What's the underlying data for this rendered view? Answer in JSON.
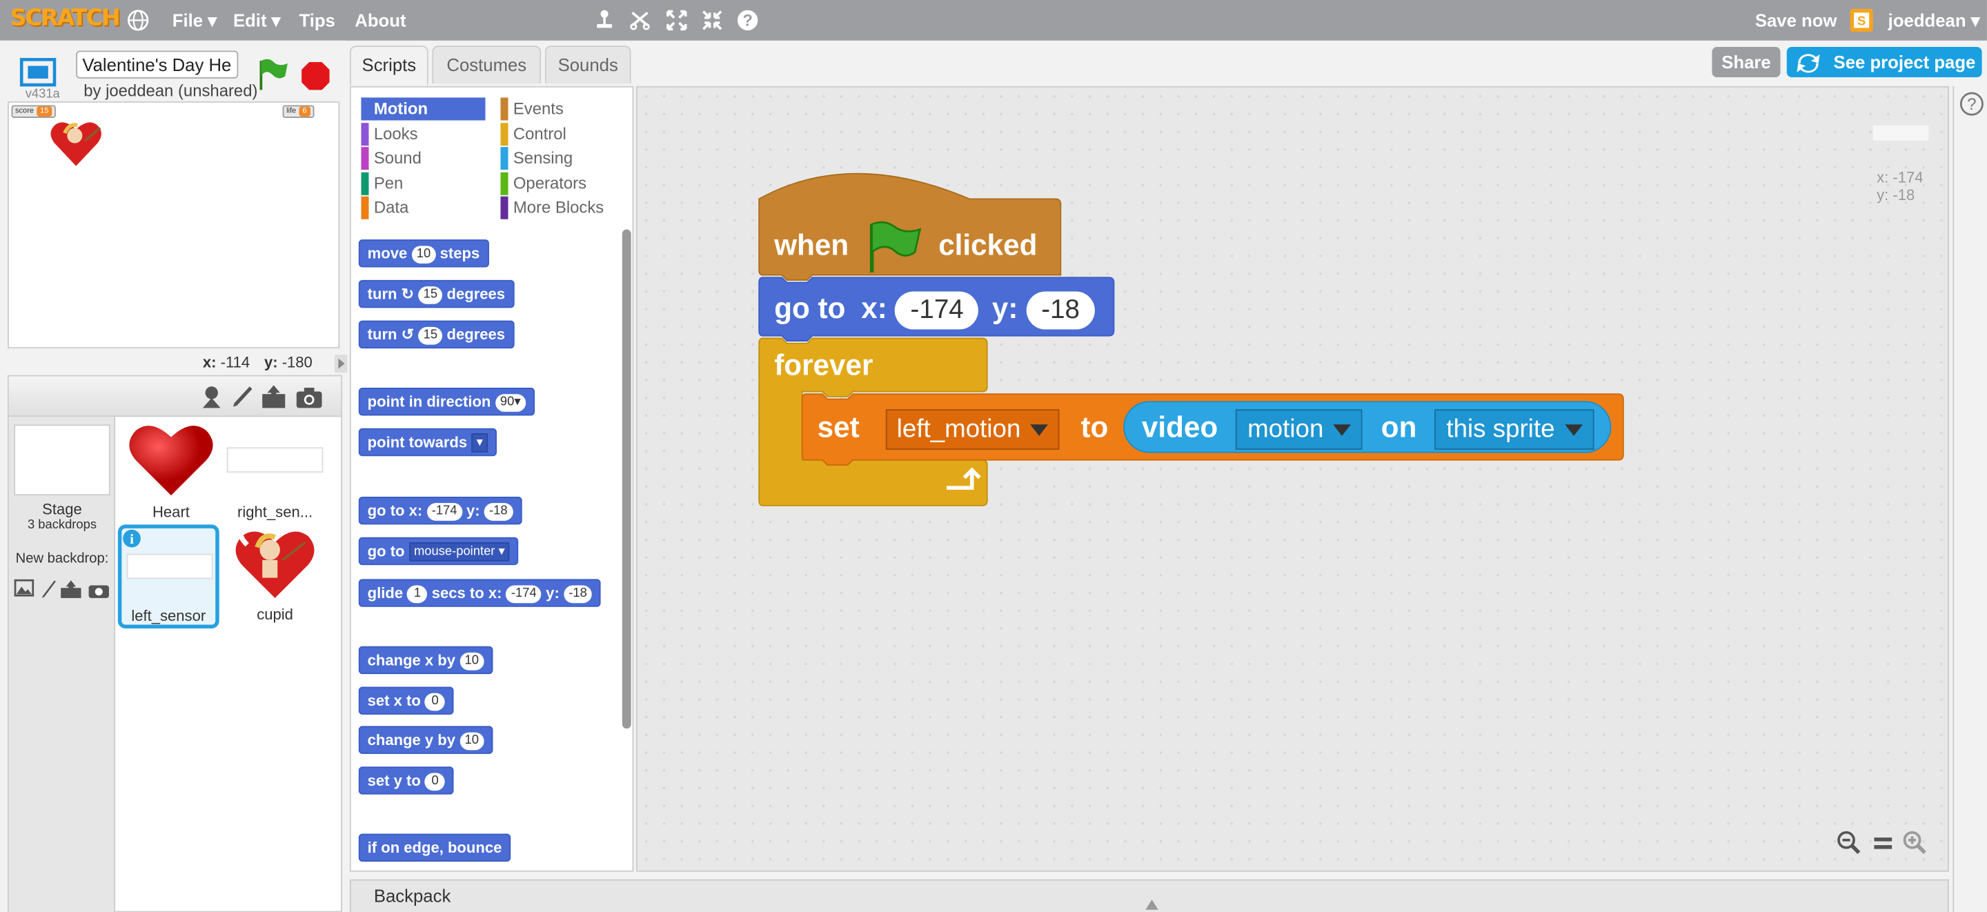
{
  "topbar": {
    "logo": "SCRATCH",
    "menus": [
      "File ▾",
      "Edit ▾",
      "Tips",
      "About"
    ],
    "save_now": "Save now",
    "username": "joeddean ▾"
  },
  "project": {
    "title": "Valentine's Day He",
    "author": "by joeddean (unshared)",
    "version": "v431a"
  },
  "stage": {
    "monitors": [
      {
        "label": "score",
        "value": "15"
      },
      {
        "label": "life",
        "value": "6"
      }
    ],
    "coords": {
      "x_label": "x:",
      "x": "-114",
      "y_label": "y:",
      "y": "-180"
    }
  },
  "sprite_pane": {
    "stage_label": "Stage",
    "backdrops": "3 backdrops",
    "new_backdrop": "New backdrop:",
    "sprites": [
      {
        "name": "Heart"
      },
      {
        "name": "right_sen..."
      },
      {
        "name": "left_sensor",
        "selected": true
      },
      {
        "name": "cupid"
      }
    ]
  },
  "tabs": [
    "Scripts",
    "Costumes",
    "Sounds"
  ],
  "categories": {
    "left": [
      {
        "name": "Motion",
        "color": "#4a6cd4"
      },
      {
        "name": "Looks",
        "color": "#8a55d7"
      },
      {
        "name": "Sound",
        "color": "#bb42c3"
      },
      {
        "name": "Pen",
        "color": "#0e9a6c"
      },
      {
        "name": "Data",
        "color": "#ee7d16"
      }
    ],
    "right": [
      {
        "name": "Events",
        "color": "#c88330"
      },
      {
        "name": "Control",
        "color": "#e1a91a"
      },
      {
        "name": "Sensing",
        "color": "#2ca5e2"
      },
      {
        "name": "Operators",
        "color": "#5cb712"
      },
      {
        "name": "More Blocks",
        "color": "#632d99"
      }
    ]
  },
  "palette": {
    "move": [
      "move",
      "10",
      "steps"
    ],
    "turn_cw": [
      "turn",
      "↻",
      "15",
      "degrees"
    ],
    "turn_ccw": [
      "turn",
      "↺",
      "15",
      "degrees"
    ],
    "point_dir": [
      "point in direction",
      "90▾"
    ],
    "point_towards": [
      "point towards",
      "▾"
    ],
    "goto_xy": [
      "go to x:",
      "-174",
      "y:",
      "-18"
    ],
    "goto": [
      "go to",
      "mouse-pointer ▾"
    ],
    "glide": [
      "glide",
      "1",
      "secs to x:",
      "-174",
      "y:",
      "-18"
    ],
    "change_x": [
      "change x by",
      "10"
    ],
    "set_x": [
      "set x to",
      "0"
    ],
    "change_y": [
      "change y by",
      "10"
    ],
    "set_y": [
      "set y to",
      "0"
    ],
    "bounce": [
      "if on edge, bounce"
    ]
  },
  "script": {
    "hat": {
      "when": "when",
      "clicked": "clicked"
    },
    "goto": {
      "label": "go to",
      "x_label": "x:",
      "x": "-174",
      "y_label": "y:",
      "y": "-18"
    },
    "forever": "forever",
    "set": {
      "label": "set",
      "var": "left_motion",
      "to": "to",
      "video": "video",
      "attr": "motion",
      "on": "on",
      "target": "this sprite"
    }
  },
  "script_coords": {
    "x": "x: -174",
    "y": "y: -18"
  },
  "buttons": {
    "share": "Share",
    "see_project": "See project page"
  },
  "backpack": "Backpack"
}
